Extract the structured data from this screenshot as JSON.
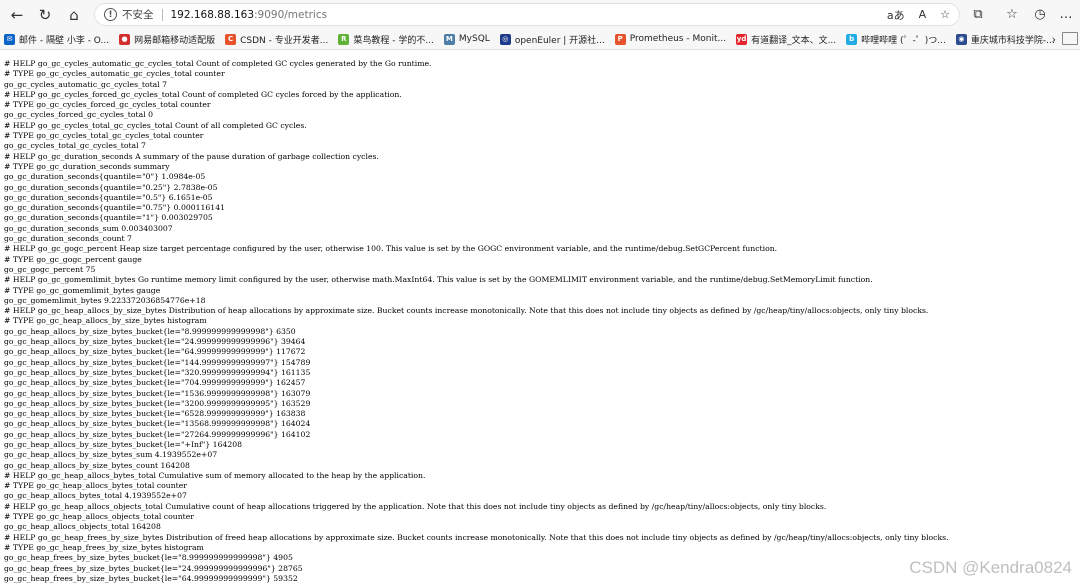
{
  "browser": {
    "back_icon": "←",
    "refresh_icon": "↻",
    "home_icon": "⌂",
    "security_label": "不安全",
    "url_host": "192.168.88.163",
    "url_path": ":9090/metrics",
    "read_aloud_icon": "aあ",
    "text_icon": "A",
    "favorite_icon": "☆",
    "extensions_icon": "⧉",
    "favorites_bar_icon": "☆",
    "history_icon": "◷",
    "more_icon": "…"
  },
  "bookmarks": [
    {
      "label": "邮件 - 隔壁 小李 - O...",
      "color": "#0a64c8",
      "glyph": "✉"
    },
    {
      "label": "网易邮箱移动适配版",
      "color": "#d32f2f",
      "glyph": "●"
    },
    {
      "label": "CSDN - 专业开发者...",
      "color": "#e8522a",
      "glyph": "C"
    },
    {
      "label": "菜鸟教程 - 学的不...",
      "color": "#5fb236",
      "glyph": "R"
    },
    {
      "label": "MySQL",
      "color": "#4d7ea8",
      "glyph": "M"
    },
    {
      "label": "openEuler | 开源社...",
      "color": "#1f3c8c",
      "glyph": "◎"
    },
    {
      "label": "Prometheus - Monit...",
      "color": "#e6522c",
      "glyph": "P"
    },
    {
      "label": "有道翻译_文本、文...",
      "color": "#e5262d",
      "glyph": "yd"
    },
    {
      "label": "哔哩哔哩 (゜-゜)つ...",
      "color": "#23ade5",
      "glyph": "b"
    },
    {
      "label": "重庆城市科技学院-...",
      "color": "#2b4d8f",
      "glyph": "◉"
    }
  ],
  "bookmarks_more": "›",
  "metrics_lines": [
    "# HELP go_gc_cycles_automatic_gc_cycles_total Count of completed GC cycles generated by the Go runtime.",
    "# TYPE go_gc_cycles_automatic_gc_cycles_total counter",
    "go_gc_cycles_automatic_gc_cycles_total 7",
    "# HELP go_gc_cycles_forced_gc_cycles_total Count of completed GC cycles forced by the application.",
    "# TYPE go_gc_cycles_forced_gc_cycles_total counter",
    "go_gc_cycles_forced_gc_cycles_total 0",
    "# HELP go_gc_cycles_total_gc_cycles_total Count of all completed GC cycles.",
    "# TYPE go_gc_cycles_total_gc_cycles_total counter",
    "go_gc_cycles_total_gc_cycles_total 7",
    "# HELP go_gc_duration_seconds A summary of the pause duration of garbage collection cycles.",
    "# TYPE go_gc_duration_seconds summary",
    "go_gc_duration_seconds{quantile=\"0\"} 1.0984e-05",
    "go_gc_duration_seconds{quantile=\"0.25\"} 2.7838e-05",
    "go_gc_duration_seconds{quantile=\"0.5\"} 6.1651e-05",
    "go_gc_duration_seconds{quantile=\"0.75\"} 0.000116141",
    "go_gc_duration_seconds{quantile=\"1\"} 0.003029705",
    "go_gc_duration_seconds_sum 0.003403007",
    "go_gc_duration_seconds_count 7",
    "# HELP go_gc_gogc_percent Heap size target percentage configured by the user, otherwise 100. This value is set by the GOGC environment variable, and the runtime/debug.SetGCPercent function.",
    "# TYPE go_gc_gogc_percent gauge",
    "go_gc_gogc_percent 75",
    "# HELP go_gc_gomemlimit_bytes Go runtime memory limit configured by the user, otherwise math.MaxInt64. This value is set by the GOMEMLIMIT environment variable, and the runtime/debug.SetMemoryLimit function.",
    "# TYPE go_gc_gomemlimit_bytes gauge",
    "go_gc_gomemlimit_bytes 9.223372036854776e+18",
    "# HELP go_gc_heap_allocs_by_size_bytes Distribution of heap allocations by approximate size. Bucket counts increase monotonically. Note that this does not include tiny objects as defined by /gc/heap/tiny/allocs:objects, only tiny blocks.",
    "# TYPE go_gc_heap_allocs_by_size_bytes histogram",
    "go_gc_heap_allocs_by_size_bytes_bucket{le=\"8.999999999999998\"} 6350",
    "go_gc_heap_allocs_by_size_bytes_bucket{le=\"24.999999999999996\"} 39464",
    "go_gc_heap_allocs_by_size_bytes_bucket{le=\"64.99999999999999\"} 117672",
    "go_gc_heap_allocs_by_size_bytes_bucket{le=\"144.99999999999997\"} 154789",
    "go_gc_heap_allocs_by_size_bytes_bucket{le=\"320.99999999999994\"} 161135",
    "go_gc_heap_allocs_by_size_bytes_bucket{le=\"704.9999999999999\"} 162457",
    "go_gc_heap_allocs_by_size_bytes_bucket{le=\"1536.9999999999998\"} 163079",
    "go_gc_heap_allocs_by_size_bytes_bucket{le=\"3200.9999999999995\"} 163529",
    "go_gc_heap_allocs_by_size_bytes_bucket{le=\"6528.999999999999\"} 163838",
    "go_gc_heap_allocs_by_size_bytes_bucket{le=\"13568.999999999998\"} 164024",
    "go_gc_heap_allocs_by_size_bytes_bucket{le=\"27264.999999999996\"} 164102",
    "go_gc_heap_allocs_by_size_bytes_bucket{le=\"+Inf\"} 164208",
    "go_gc_heap_allocs_by_size_bytes_sum 4.1939552e+07",
    "go_gc_heap_allocs_by_size_bytes_count 164208",
    "# HELP go_gc_heap_allocs_bytes_total Cumulative sum of memory allocated to the heap by the application.",
    "# TYPE go_gc_heap_allocs_bytes_total counter",
    "go_gc_heap_allocs_bytes_total 4.1939552e+07",
    "# HELP go_gc_heap_allocs_objects_total Cumulative count of heap allocations triggered by the application. Note that this does not include tiny objects as defined by /gc/heap/tiny/allocs:objects, only tiny blocks.",
    "# TYPE go_gc_heap_allocs_objects_total counter",
    "go_gc_heap_allocs_objects_total 164208",
    "# HELP go_gc_heap_frees_by_size_bytes Distribution of freed heap allocations by approximate size. Bucket counts increase monotonically. Note that this does not include tiny objects as defined by /gc/heap/tiny/allocs:objects, only tiny blocks.",
    "# TYPE go_gc_heap_frees_by_size_bytes histogram",
    "go_gc_heap_frees_by_size_bytes_bucket{le=\"8.999999999999998\"} 4905",
    "go_gc_heap_frees_by_size_bytes_bucket{le=\"24.999999999999996\"} 28765",
    "go_gc_heap_frees_by_size_bytes_bucket{le=\"64.99999999999999\"} 59352"
  ],
  "watermark": "CSDN @Kendra0824"
}
